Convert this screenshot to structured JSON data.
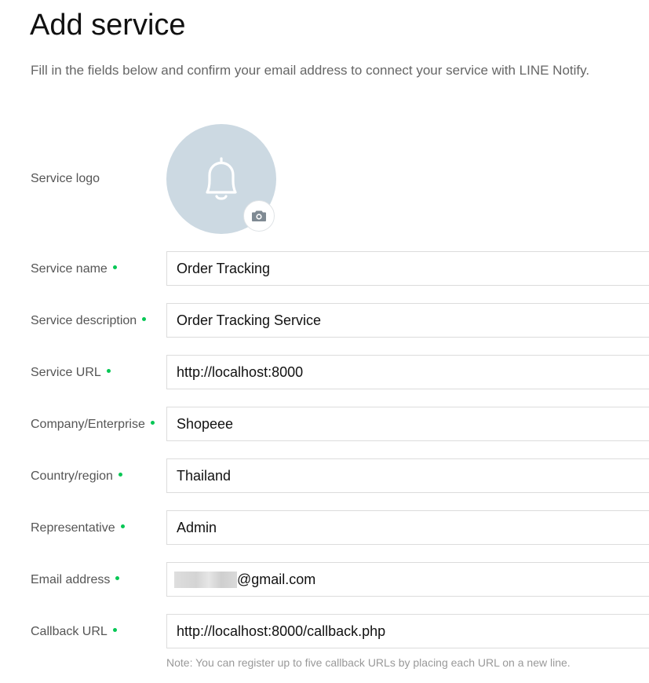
{
  "header": {
    "title": "Add service",
    "intro": "Fill in the fields below and confirm your email address to connect your service with LINE Notify."
  },
  "logo": {
    "label": "Service logo",
    "placeholder_icon": "bell-icon",
    "upload_icon": "camera-icon",
    "circle_color": "#ccd9e2"
  },
  "fields": {
    "service_name": {
      "label": "Service name",
      "value": "Order Tracking",
      "required": true
    },
    "service_description": {
      "label": "Service description",
      "value": "Order Tracking Service",
      "required": true
    },
    "service_url": {
      "label": "Service URL",
      "value": "http://localhost:8000",
      "required": true
    },
    "company": {
      "label": "Company/Enterprise",
      "value": "Shopeee",
      "required": true
    },
    "country": {
      "label": "Country/region",
      "value": "Thailand",
      "required": true
    },
    "representative": {
      "label": "Representative",
      "value": "Admin",
      "required": true
    },
    "email": {
      "label": "Email address",
      "value_visible_suffix": "@gmail.com",
      "required": true
    },
    "callback_url": {
      "label": "Callback URL",
      "value": "http://localhost:8000/callback.php",
      "required": true
    }
  },
  "note": "Note: You can register up to five callback URLs by placing each URL on a new line.",
  "colors": {
    "required_dot": "#06c755",
    "label_text": "#555555",
    "note_text": "#999999"
  }
}
